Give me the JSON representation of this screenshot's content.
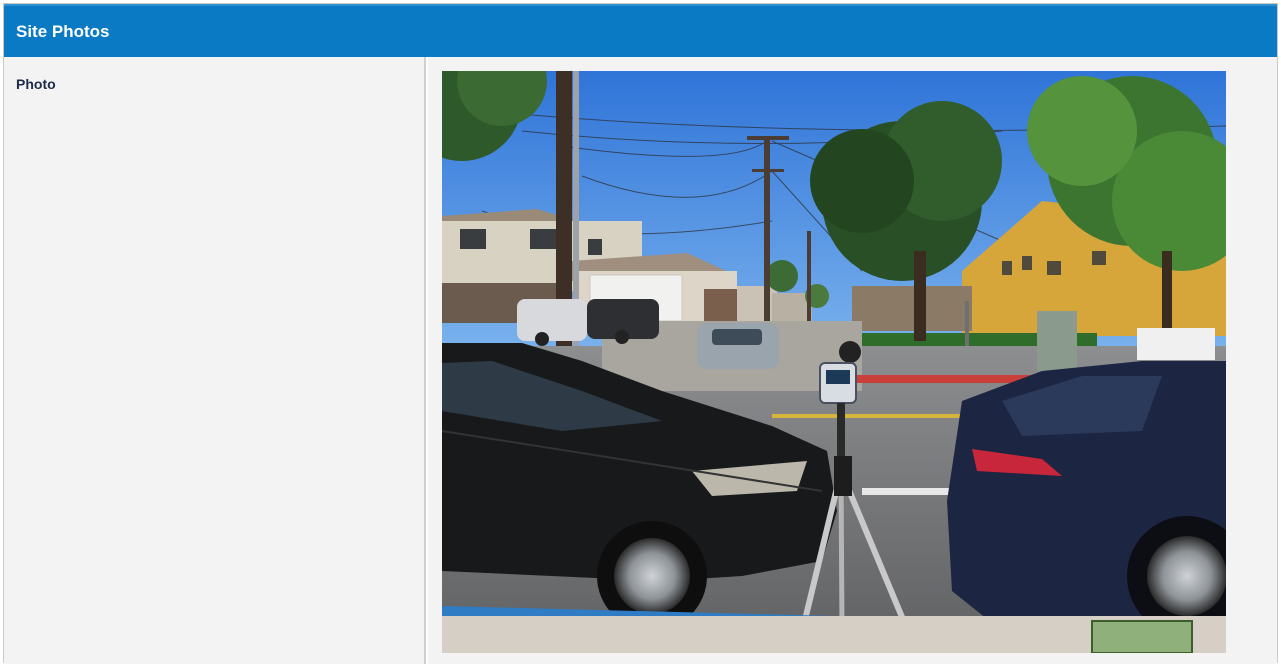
{
  "section": {
    "title": "Site Photos"
  },
  "row": {
    "label": "Photo"
  },
  "photo": {
    "subject": "street scene with sound level meter on tripod between parked cars"
  },
  "colors": {
    "header_bg": "#0a7ac4",
    "header_text": "#ffffff",
    "cell_bg": "#f3f3f3",
    "label_text": "#1e2a4a",
    "divider": "#cfcfcf"
  }
}
